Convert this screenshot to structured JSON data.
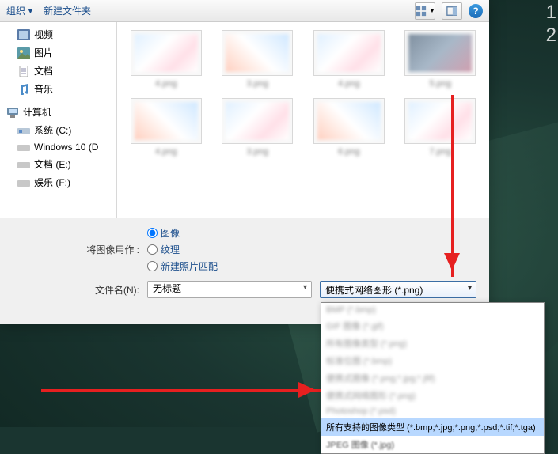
{
  "toolbar": {
    "organize": "组织",
    "new_folder": "新建文件夹"
  },
  "sidebar": {
    "video": "视频",
    "pictures": "图片",
    "documents": "文档",
    "music": "音乐",
    "computer": "计算机",
    "drive_system": "系统 (C:)",
    "drive_win10": "Windows 10 (D",
    "drive_docs": "文档 (E:)",
    "drive_ent": "娱乐 (F:)"
  },
  "files": {
    "items": [
      "4.png",
      "3.png",
      "4.png",
      "5.png",
      "4.png",
      "3.png",
      "6.png",
      "7.png"
    ]
  },
  "options": {
    "use_as_label": "将图像用作 :",
    "image": "图像",
    "texture": "纹理",
    "new_photo_match": "新建照片匹配"
  },
  "filename": {
    "label": "文件名(N):",
    "value": "无标题"
  },
  "filetype": {
    "selected": "便携式网络图形 (*.png)",
    "options_blur": [
      "BMP (*.bmp)",
      "GIF 图像 (*.gif)",
      "所有图像类型 (*.png)",
      "标准位图 (*.bmp)",
      "便携式图像 (*.png;*.jpg;*.jfif)",
      "便携式网络图形 (*.png)",
      "Photoshop (*.psd)"
    ],
    "all_supported": "所有支持的图像类型 (*.bmp;*.jpg;*.png;*.psd;*.tif;*.tga)",
    "jpeg": "JPEG 图像 (*.jpg)"
  }
}
